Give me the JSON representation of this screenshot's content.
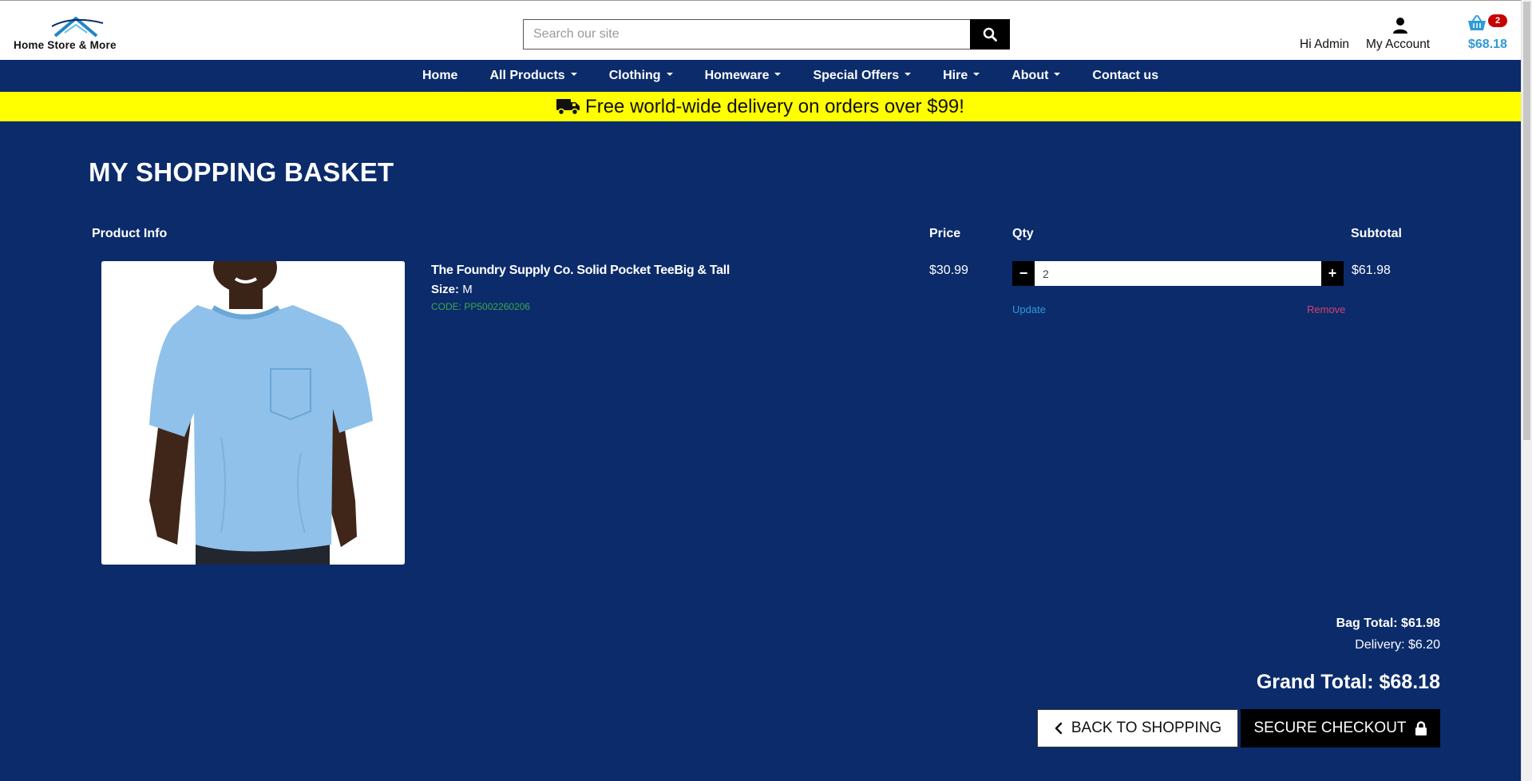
{
  "header": {
    "logo_text": "Home Store & More",
    "search_placeholder": "Search our site",
    "greeting": "Hi Admin",
    "account_label": "My Account",
    "cart_count": "2",
    "cart_total": "$68.18"
  },
  "nav": {
    "items": [
      {
        "label": "Home"
      },
      {
        "label": "All Products"
      },
      {
        "label": "Clothing"
      },
      {
        "label": "Homeware"
      },
      {
        "label": "Special Offers"
      },
      {
        "label": "Hire"
      },
      {
        "label": "About"
      },
      {
        "label": "Contact us"
      }
    ]
  },
  "promo": {
    "text": "Free world-wide delivery on orders over $99!",
    "icon": "truck-icon",
    "background": "#ffff00"
  },
  "basket": {
    "title": "MY SHOPPING BASKET",
    "headers": {
      "product_info": "Product Info",
      "price": "Price",
      "qty": "Qty",
      "subtotal": "Subtotal"
    },
    "items": [
      {
        "name": "The Foundry Supply Co. Solid Pocket TeeBig & Tall",
        "size_label": "Size:",
        "size_value": "M",
        "code": "CODE: PP5002260206",
        "price": "$30.99",
        "qty": "2",
        "subtotal": "$61.98",
        "update_label": "Update",
        "remove_label": "Remove"
      }
    ],
    "bag_total": "Bag Total: $61.98",
    "delivery": "Delivery: $6.20",
    "grand_total": "Grand Total: $68.18"
  },
  "actions": {
    "back_label": "BACK TO SHOPPING",
    "checkout_label": "SECURE CHECKOUT"
  },
  "colors": {
    "page_bg": "#0b2b6b",
    "accent_blue": "#2e9ad8",
    "code_green": "#3ea84a",
    "remove_red": "#d8426a",
    "badge_red": "#c80000"
  }
}
